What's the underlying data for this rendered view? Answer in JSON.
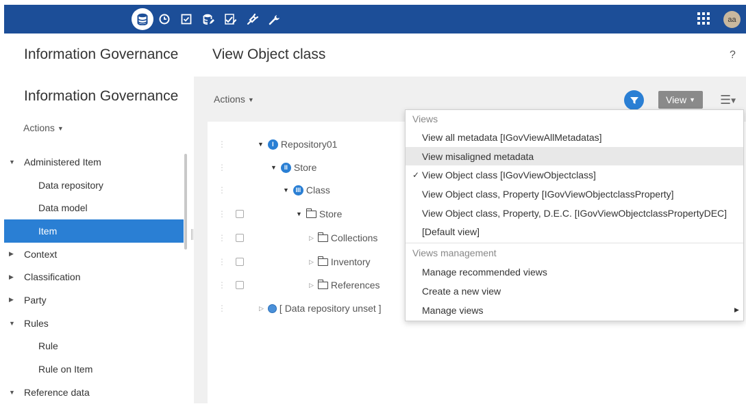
{
  "topbar": {
    "icons": [
      "database-icon",
      "clock-icon",
      "checklist-icon",
      "database-edit-icon",
      "check-edit-icon",
      "plug-icon",
      "wrench-icon"
    ],
    "avatar": "aa",
    "color": "#1c4e98"
  },
  "left": {
    "app_title": "Information Governance",
    "section_title": "Information Governance",
    "actions_label": "Actions",
    "tree": [
      {
        "label": "Administered Item",
        "expanded": true,
        "level": 0
      },
      {
        "label": "Data repository",
        "level": 1
      },
      {
        "label": "Data model",
        "level": 1
      },
      {
        "label": "Item",
        "level": 1,
        "selected": true
      },
      {
        "label": "Context",
        "expanded": false,
        "level": 0
      },
      {
        "label": "Classification",
        "expanded": false,
        "level": 0
      },
      {
        "label": "Party",
        "expanded": false,
        "level": 0
      },
      {
        "label": "Rules",
        "expanded": true,
        "level": 0
      },
      {
        "label": "Rule",
        "level": 1
      },
      {
        "label": "Rule on Item",
        "level": 1
      },
      {
        "label": "Reference data",
        "expanded": true,
        "level": 0
      }
    ]
  },
  "main": {
    "title": "View Object class",
    "help": "?",
    "actions_label": "Actions",
    "view_button": "View",
    "accent": "#2a7fd4",
    "tree": [
      {
        "label": "Repository01",
        "badge": "I"
      },
      {
        "label": "Store",
        "badge": "II"
      },
      {
        "label": "Class",
        "badge": "III"
      },
      {
        "label": "Store"
      },
      {
        "label": "Collections"
      },
      {
        "label": "Inventory"
      },
      {
        "label": "References"
      },
      {
        "label": "[ Data repository unset ]"
      }
    ]
  },
  "dropdown": {
    "views_header": "Views",
    "views": [
      {
        "label": "View all metadata [IGovViewAllMetadatas]"
      },
      {
        "label": "View misaligned metadata",
        "highlighted": true
      },
      {
        "label": "View Object class [IGovViewObjectclass]",
        "checked": true
      },
      {
        "label": "View Object class, Property [IGovViewObjectclassProperty]"
      },
      {
        "label": "View Object class, Property, D.E.C. [IGovViewObjectclassPropertyDEC]"
      },
      {
        "label": "[Default view]"
      }
    ],
    "management_header": "Views management",
    "management": [
      {
        "label": "Manage recommended views"
      },
      {
        "label": "Create a new view"
      },
      {
        "label": "Manage views",
        "submenu": true
      }
    ],
    "check_mark": "✓"
  }
}
